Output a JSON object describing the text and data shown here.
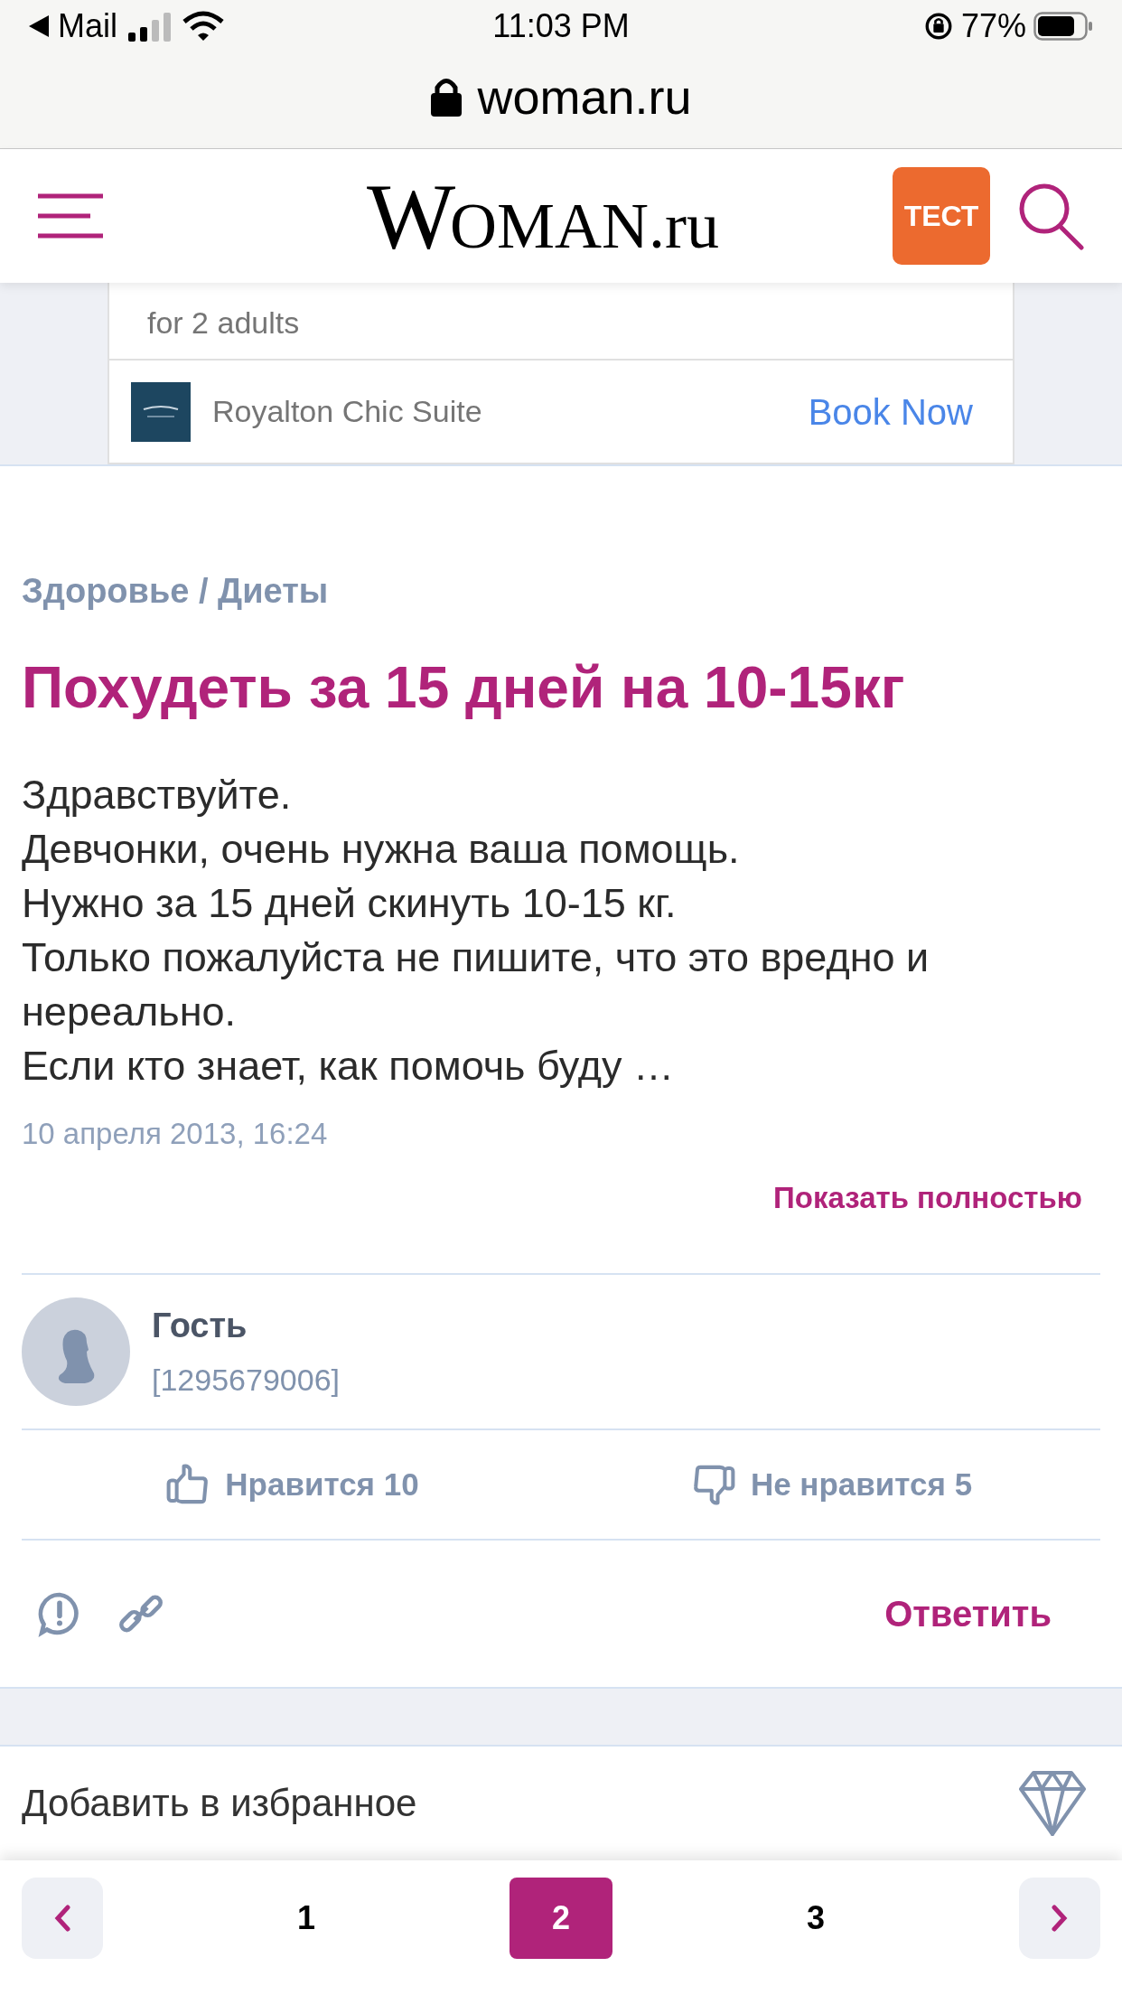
{
  "status_bar": {
    "back_app": "Mail",
    "time": "11:03 PM",
    "battery": "77%"
  },
  "url_bar": {
    "domain": "woman.ru"
  },
  "header": {
    "logo_big": "W",
    "logo_rest": "OMAN",
    "logo_suffix": ".ru",
    "test_badge": "ТЕСТ"
  },
  "ad": {
    "text": "for 2 adults",
    "brand": "Royalton Chic Suite",
    "cta": "Book Now"
  },
  "article": {
    "breadcrumb": "Здоровье / Диеты",
    "title": "Похудеть за 15 дней на 10-15кг",
    "body": [
      "Здравствуйте.",
      "Девчонки, очень нужна ваша помощь.",
      "Нужно за 15 дней скинуть 10-15 кг.",
      "Только пожалуйста не пишите, что это вредно и нереально.",
      "Если кто знает, как помочь буду …"
    ],
    "date": "10 апреля 2013, 16:24",
    "show_more": "Показать полностью"
  },
  "author": {
    "name": "Гость",
    "id": "[1295679006]"
  },
  "reactions": [
    {
      "kind": "like",
      "label": "Нравится 10"
    },
    {
      "kind": "dislike",
      "label": "Не нравится 5"
    }
  ],
  "reply": "Ответить",
  "favorite": "Добавить в избранное",
  "pagination": [
    {
      "label": "1",
      "selected": false
    },
    {
      "label": "2",
      "selected": true
    },
    {
      "label": "3",
      "selected": false
    }
  ]
}
